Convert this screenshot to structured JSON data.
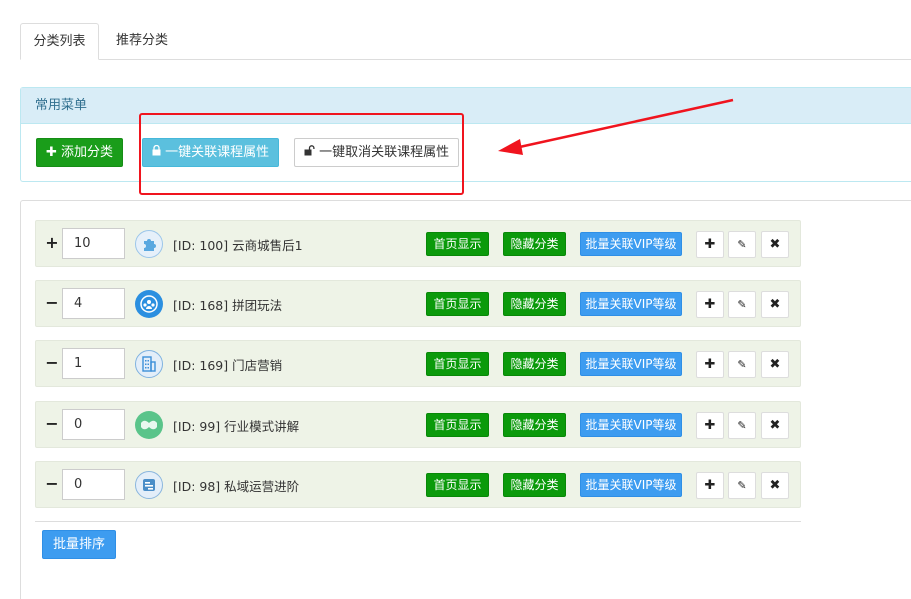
{
  "tabs": [
    {
      "label": "分类列表",
      "active": true
    },
    {
      "label": "推荐分类",
      "active": false
    }
  ],
  "panel": {
    "title": "常用菜单",
    "add_label": "添加分类",
    "link_label": "一键关联课程属性",
    "unlink_label": "一键取消关联课程属性"
  },
  "rows": [
    {
      "toggle": "+",
      "order": "10",
      "name": "[ID: 100] 云商城售后1",
      "icon": "puzzle-icon",
      "icon_color": "#5aa8e0"
    },
    {
      "toggle": "−",
      "order": "4",
      "name": "[ID: 168] 拼团玩法",
      "icon": "group-icon",
      "icon_color": "#2b8fe0"
    },
    {
      "toggle": "−",
      "order": "1",
      "name": "[ID: 169] 门店营销",
      "icon": "building-icon",
      "icon_color": "#3d8fd8"
    },
    {
      "toggle": "−",
      "order": "0",
      "name": "[ID: 99] 行业模式讲解",
      "icon": "mustache-icon",
      "icon_color": "#5ac48a"
    },
    {
      "toggle": "−",
      "order": "0",
      "name": "[ID: 98] 私域运营进阶",
      "icon": "tools-icon",
      "icon_color": "#4a8ec8"
    }
  ],
  "row_actions": {
    "home_label": "首页显示",
    "hide_label": "隐藏分类",
    "vip_label": "批量关联VIP等级"
  },
  "batch_sort_label": "批量排序",
  "colors": {
    "green": "#0b9a0b",
    "blue": "#3d9cf0",
    "info": "#5bc0de",
    "annotation_red": "#f0141e"
  }
}
